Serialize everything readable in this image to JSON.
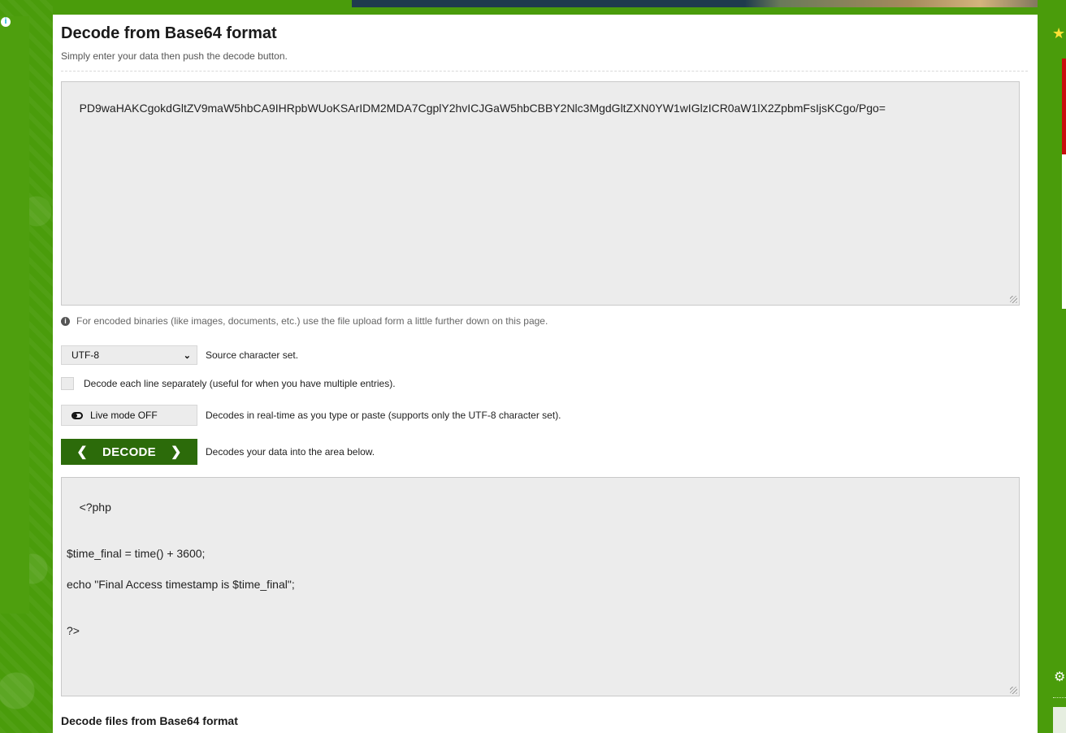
{
  "page": {
    "title": "Decode from Base64 format",
    "subtitle": "Simply enter your data then push the decode button."
  },
  "input": {
    "value": "PD9waHAKCgokdGltZV9maW5hbCA9IHRpbWUoKSArIDM2MDA7CgplY2hvICJGaW5hbCBBY2Nlc3MgdGltZXN0YW1wIGlzICR0aW1lX2ZpbmFsIjsKCgo/Pgo="
  },
  "note": {
    "icon": "info-icon",
    "text": "For encoded binaries (like images, documents, etc.) use the file upload form a little further down on this page."
  },
  "charset": {
    "selected": "UTF-8",
    "label": "Source character set."
  },
  "line_option": {
    "checked": false,
    "label": "Decode each line separately (useful for when you have multiple entries)."
  },
  "live_mode": {
    "button_label": "Live mode OFF",
    "description": "Decodes in real-time as you type or paste (supports only the UTF-8 character set)."
  },
  "decode": {
    "button_label": "DECODE",
    "description": "Decodes your data into the area below."
  },
  "output": {
    "value": "<?php\n\n\n$time_final = time() + 3600;\n\necho \"Final Access timestamp is $time_final\";\n\n\n?>"
  },
  "files_section": {
    "title": "Decode files from Base64 format"
  },
  "colors": {
    "background": "#4a9c0b",
    "decode_button": "#2c6b0a",
    "textarea": "#ececec"
  }
}
